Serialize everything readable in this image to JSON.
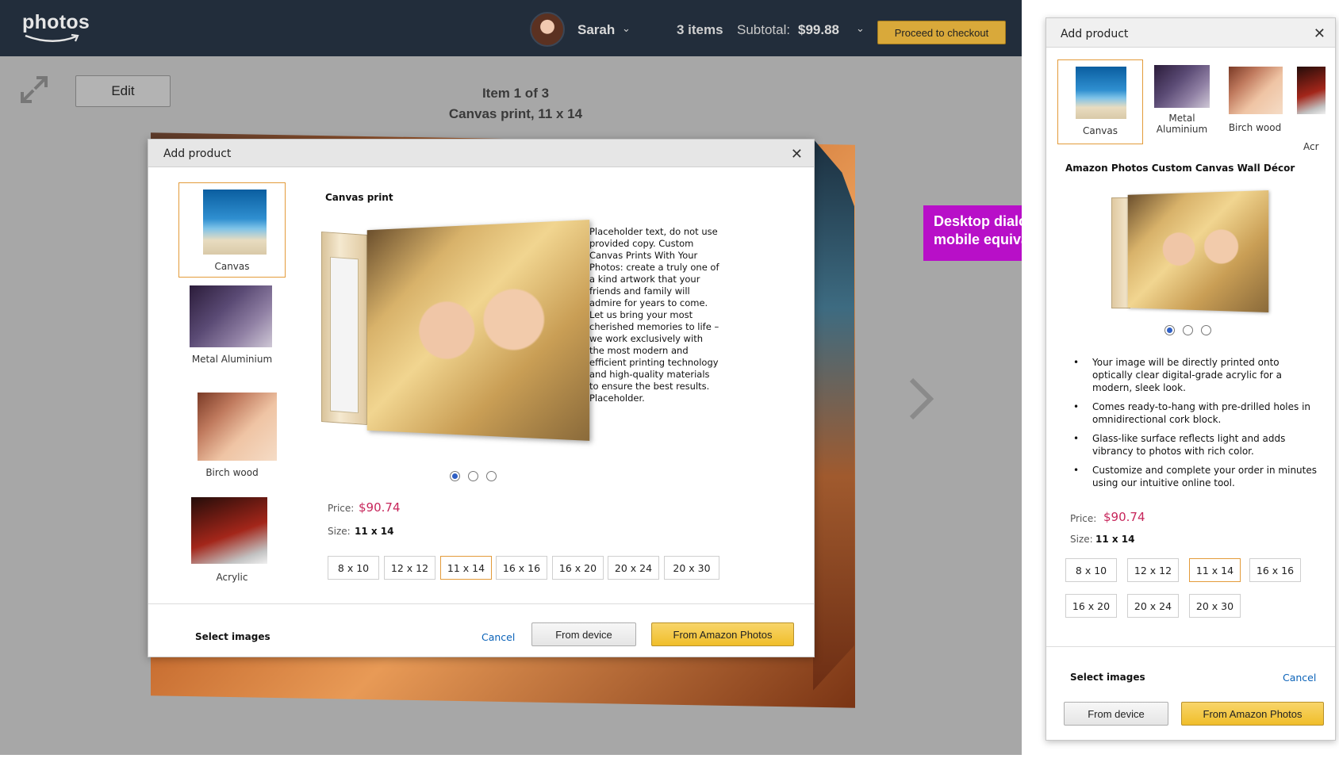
{
  "header": {
    "logo": "photos",
    "user_name": "Sarah",
    "items_count": "3 items",
    "subtotal_label": "Subtotal:",
    "subtotal_value": "$99.88",
    "checkout_label": "Proceed to checkout"
  },
  "toolbar": {
    "edit_label": "Edit"
  },
  "item": {
    "title": "Item 1 of 3",
    "subtitle": "Canvas print, 11 x 14"
  },
  "desktop_dialog": {
    "title": "Add product",
    "products": [
      {
        "label": "Canvas",
        "selected": true
      },
      {
        "label": "Metal Aluminium",
        "selected": false
      },
      {
        "label": "Birch wood",
        "selected": false
      },
      {
        "label": "Acrylic",
        "selected": false
      }
    ],
    "section_title": "Canvas print",
    "description": "Placeholder text, do not use provided copy. Custom Canvas Prints With Your Photos: create a truly one of a kind artwork that your friends and family will admire for years to come. Let us bring your most cherished memories to life – we work exclusively with the most modern and efficient printing technology and high-quality materials to ensure the best results. Placeholder.",
    "price_label": "Price:",
    "price_value": "$90.74",
    "size_label": "Size:",
    "size_value": "11 x 14",
    "sizes": [
      "8 x 10",
      "12 x 12",
      "11 x 14",
      "16 x 16",
      "16 x 20",
      "20 x 24",
      "20 x 30"
    ],
    "selected_size": "11 x 14",
    "select_images_label": "Select images",
    "cancel_label": "Cancel",
    "from_device_label": "From device",
    "from_amazon_label": "From Amazon Photos"
  },
  "annotation": {
    "text": "Desktop dialogs and mobile equivalents"
  },
  "mobile_dialog": {
    "title": "Add product",
    "products": [
      {
        "label": "Canvas",
        "selected": true
      },
      {
        "label": "Metal Aluminium",
        "selected": false
      },
      {
        "label": "Birch wood",
        "selected": false
      },
      {
        "label": "Acr",
        "selected": false
      }
    ],
    "product_title": "Amazon Photos Custom Canvas Wall Décor",
    "bullets": [
      "Your image will be directly printed onto optically clear digital-grade acrylic for a modern, sleek look.",
      "Comes ready-to-hang with pre-drilled holes in omnidirectional cork block.",
      "Glass-like surface reflects light and adds vibrancy to photos with rich color.",
      "Customize and complete your order in minutes using our intuitive online tool."
    ],
    "price_label": "Price:",
    "price_value": "$90.74",
    "size_label": "Size:",
    "size_value": "11 x 14",
    "sizes": [
      "8 x 10",
      "12 x 12",
      "11 x 14",
      "16 x 16",
      "16 x 20",
      "20 x 24",
      "20 x 30"
    ],
    "selected_size": "11 x 14",
    "select_images_label": "Select images",
    "cancel_label": "Cancel",
    "from_device_label": "From device",
    "from_amazon_label": "From Amazon Photos"
  },
  "colors": {
    "topbar": "#222d3b",
    "accent_orange": "#e39b3a",
    "price_pink": "#c7265b",
    "link_blue": "#0a62b8",
    "callout_magenta": "#b80fc8",
    "primary_button": "#f0be2a"
  },
  "icons": {
    "expand": "expand-arrows-icon",
    "close": "close-icon",
    "chevron": "chevron-down-icon",
    "next": "chevron-right-icon"
  }
}
